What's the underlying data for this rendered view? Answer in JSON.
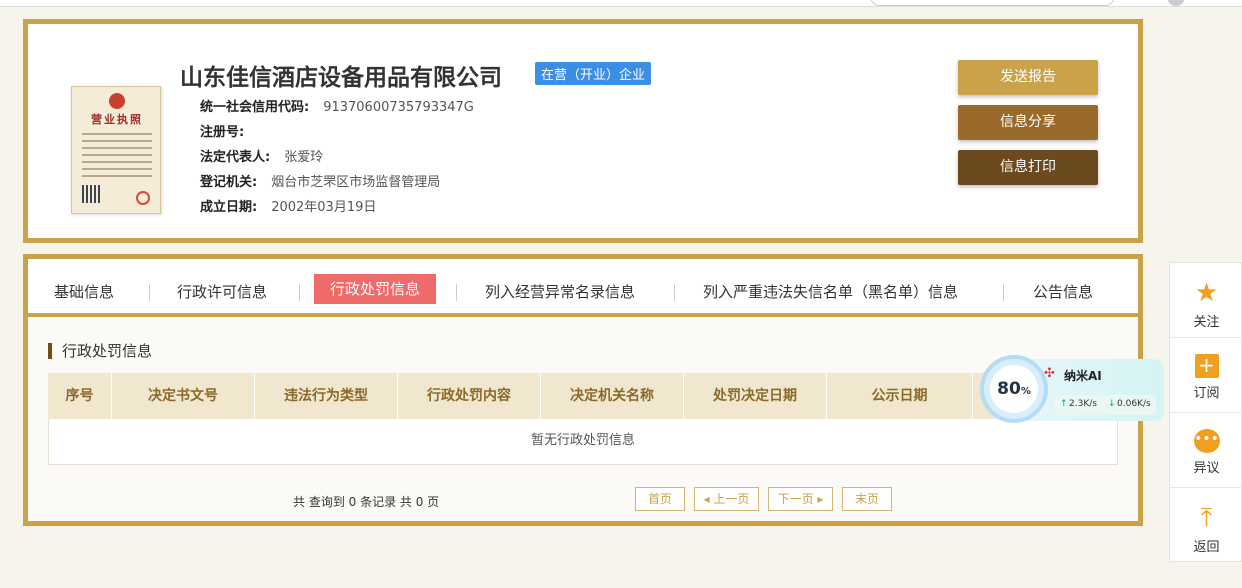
{
  "company": {
    "name": "山东佳信酒店设备用品有限公司",
    "status": "在营（开业）企业",
    "license_title": "营业执照",
    "fields": [
      {
        "key": "统一社会信用代码:",
        "value": "91370600735793347G"
      },
      {
        "key": "注册号:",
        "value": ""
      },
      {
        "key": "法定代表人:",
        "value": "张爱玲"
      },
      {
        "key": "登记机关:",
        "value": "烟台市芝罘区市场监督管理局"
      },
      {
        "key": "成立日期:",
        "value": "2002年03月19日"
      }
    ]
  },
  "actions": {
    "report": "发送报告",
    "share": "信息分享",
    "print": "信息打印"
  },
  "tabs": [
    {
      "label": "基础信息"
    },
    {
      "label": "行政许可信息"
    },
    {
      "label": "行政处罚信息",
      "active": true
    },
    {
      "label": "列入经营异常名录信息"
    },
    {
      "label": "列入严重违法失信名单（黑名单）信息"
    },
    {
      "label": "公告信息"
    }
  ],
  "section": {
    "title": "行政处罚信息",
    "columns": [
      "序号",
      "决定书文号",
      "违法行为类型",
      "行政处罚内容",
      "决定机关名称",
      "处罚决定日期",
      "公示日期"
    ],
    "empty": "暂无行政处罚信息"
  },
  "pager": {
    "summary": "共 查询到 0 条记录 共 0 页",
    "first": "首页",
    "prev": "◂ 上一页",
    "next": "下一页 ▸",
    "last": "末页"
  },
  "sidebar": {
    "follow": "关注",
    "subscribe": "订阅",
    "dispute": "异议",
    "back": "返回"
  },
  "widget": {
    "percent": "80",
    "percent_unit": "%",
    "brand": "纳米AI",
    "up": "2.3K/s",
    "down": "0.06K/s"
  },
  "colors": {
    "accent": "#c9a24a",
    "active_tab": "#f06a6a",
    "badge": "#3a8ee6"
  }
}
